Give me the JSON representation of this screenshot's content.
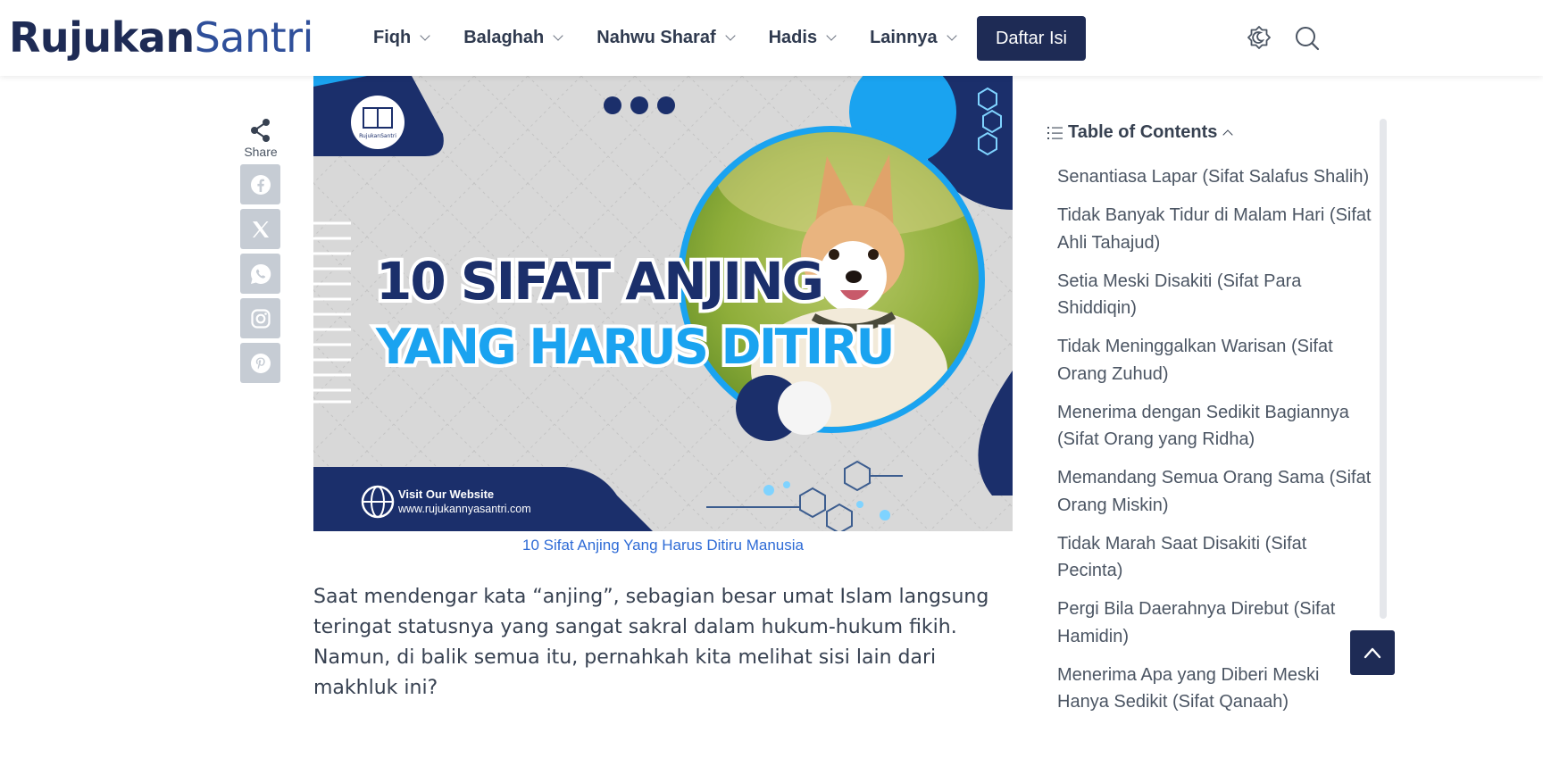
{
  "header": {
    "logo_part1": "Rujukan",
    "logo_part2": "Santri",
    "nav": [
      {
        "label": "Fiqh"
      },
      {
        "label": "Balaghah"
      },
      {
        "label": "Nahwu Sharaf"
      },
      {
        "label": "Hadis"
      },
      {
        "label": "Lainnya"
      }
    ],
    "cta_label": "Daftar Isi",
    "icons": [
      "theme-toggle-icon",
      "search-icon"
    ]
  },
  "share": {
    "label": "Share",
    "buttons": [
      "facebook-icon",
      "x-icon",
      "whatsapp-icon",
      "instagram-icon",
      "pinterest-icon"
    ]
  },
  "hero": {
    "logo_text": "RujukanSantri",
    "title_line1": "10 SIFAT ANJING",
    "title_line2": "YANG HARUS DITIRU",
    "visit_label": "Visit Our Website",
    "visit_url": "www.rujukannyasantri.com"
  },
  "article": {
    "caption": "10 Sifat Anjing Yang Harus Ditiru Manusia",
    "paragraph": "Saat mendengar kata “anjing”, sebagian besar umat Islam langsung teringat statusnya yang sangat sakral dalam hukum-hukum fikih. Namun, di balik semua itu, pernahkah kita melihat sisi lain dari makhluk ini?"
  },
  "toc": {
    "title": "Table of Contents",
    "items": [
      "Senantiasa Lapar (Sifat Salafus Shalih)",
      "Tidak Banyak Tidur di Malam Hari (Sifat Ahli Tahajud)",
      "Setia Meski Disakiti (Sifat Para Shiddiqin)",
      "Tidak Meninggalkan Warisan (Sifat Orang Zuhud)",
      "Menerima dengan Sedikit Bagiannya (Sifat Orang yang Ridha)",
      "Memandang Semua Orang Sama (Sifat Orang Miskin)",
      "Tidak Marah Saat Disakiti (Sifat Pecinta)",
      "Pergi Bila Daerahnya Direbut (Sifat Hamidin)",
      "Menerima Apa yang Diberi Meski Hanya Sedikit (Sifat Qanaah)"
    ]
  },
  "colors": {
    "brand_dark": "#1e2b55",
    "brand_blue": "#2f4f9a",
    "link_blue": "#2e6bd6",
    "hero_accent": "#1aa3f0"
  }
}
